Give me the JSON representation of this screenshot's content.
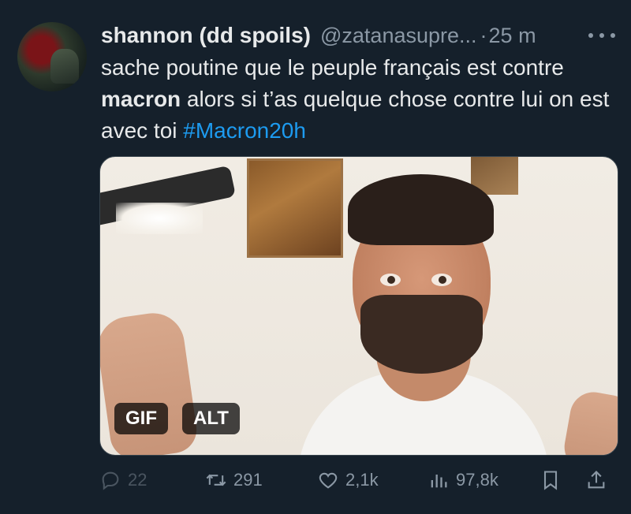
{
  "tweet": {
    "display_name": "shannon (dd spoils)",
    "handle": "@zatanasupre...",
    "separator": "·",
    "time": "25 m",
    "text_part1": "sache poutine que le peuple français est contre ",
    "text_bold": "macron",
    "text_part2": " alors si t’as quelque chose contre lui on est avec toi  ",
    "hashtag": "#Macron20h"
  },
  "media": {
    "gif_badge": "GIF",
    "alt_badge": "ALT"
  },
  "actions": {
    "replies": "22",
    "retweets": "291",
    "likes": "2,1k",
    "views": "97,8k"
  },
  "icons": {
    "reply": "reply-icon",
    "retweet": "retweet-icon",
    "like": "heart-icon",
    "views": "views-icon",
    "bookmark": "bookmark-icon",
    "share": "share-icon",
    "more": "more-icon"
  },
  "colors": {
    "background": "#15202b",
    "text": "#e7e9ea",
    "muted": "#8b98a5",
    "link": "#1d9bf0"
  }
}
